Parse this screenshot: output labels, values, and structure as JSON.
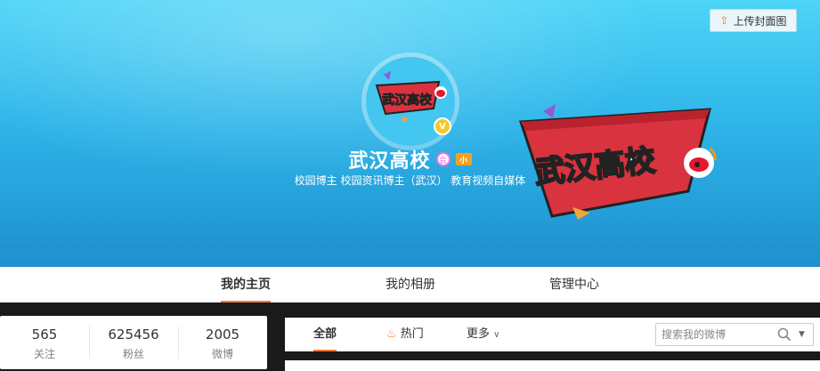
{
  "cover": {
    "upload_label": "上传封面图",
    "upload_icon": "upload-icon",
    "background_color": "#35c1ee"
  },
  "profile": {
    "avatar_text": "武汉高校",
    "verified_badge": "V",
    "name": "武汉高校",
    "member_badge": "会",
    "level_badge": "小",
    "description": "校园博主 校园资讯博主（武汉） 教育视频自媒体"
  },
  "banner_art": {
    "text": "武汉高校"
  },
  "nav": {
    "tabs": [
      {
        "label": "我的主页",
        "active": true
      },
      {
        "label": "我的相册",
        "active": false
      },
      {
        "label": "管理中心",
        "active": false
      }
    ],
    "accent": "#fa7d3c"
  },
  "stats": [
    {
      "value": "565",
      "label": "关注"
    },
    {
      "value": "625456",
      "label": "粉丝"
    },
    {
      "value": "2005",
      "label": "微博"
    }
  ],
  "feed": {
    "tabs": [
      {
        "label": "全部",
        "active": true
      },
      {
        "label": "热门",
        "icon": "flame-icon"
      },
      {
        "label": "更多",
        "icon": "chevron-down-icon"
      }
    ],
    "search_placeholder": "搜索我的微博",
    "search_icon": "search-icon"
  }
}
